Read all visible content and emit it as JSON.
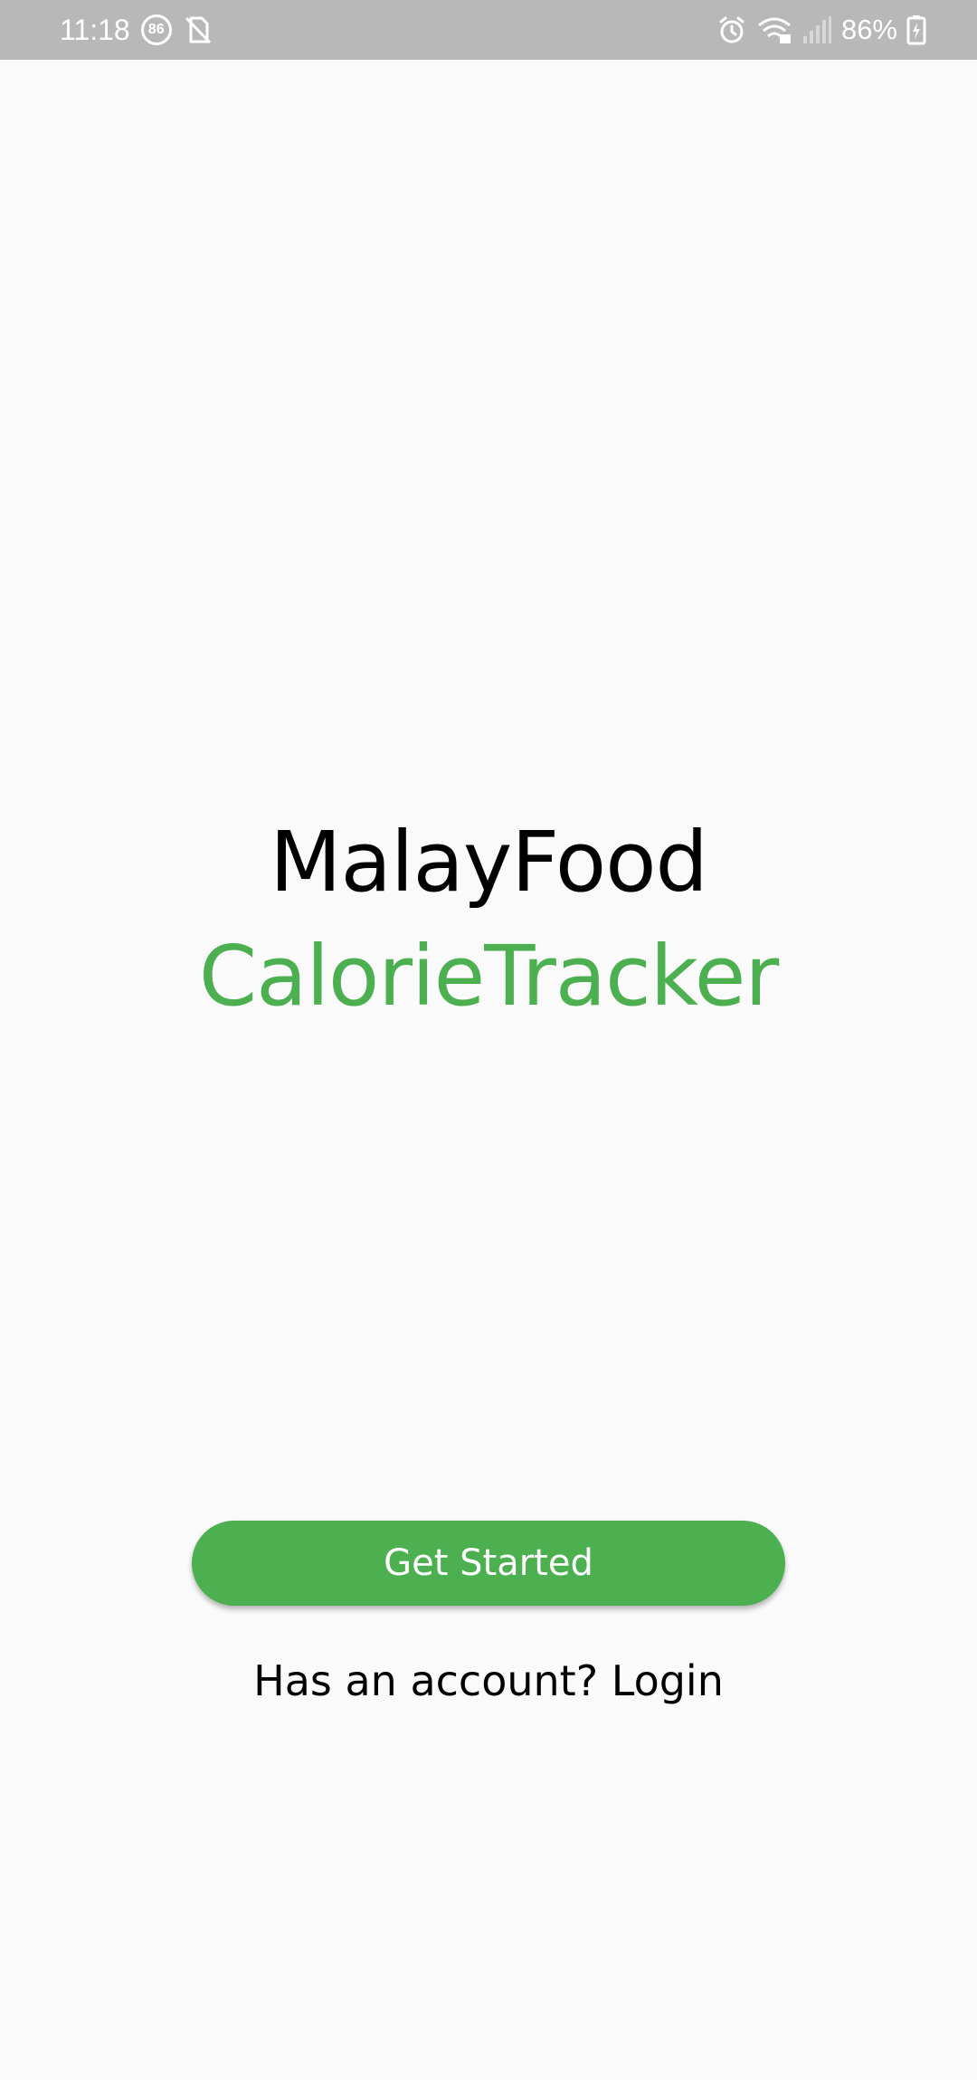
{
  "status_bar": {
    "time": "11:18",
    "notification_badge": "86",
    "battery_percent": "86%",
    "icons": [
      "alarm-icon",
      "wifi-icon",
      "signal-icon",
      "battery-charging-icon",
      "no-sim-icon"
    ],
    "background_color": "#b8b8b8"
  },
  "app": {
    "title_line1": "MalayFood",
    "title_line2": "CalorieTracker",
    "accent_color": "#4caf50"
  },
  "actions": {
    "get_started_label": "Get Started",
    "login_prompt": "Has an account?",
    "login_label": "Login"
  }
}
